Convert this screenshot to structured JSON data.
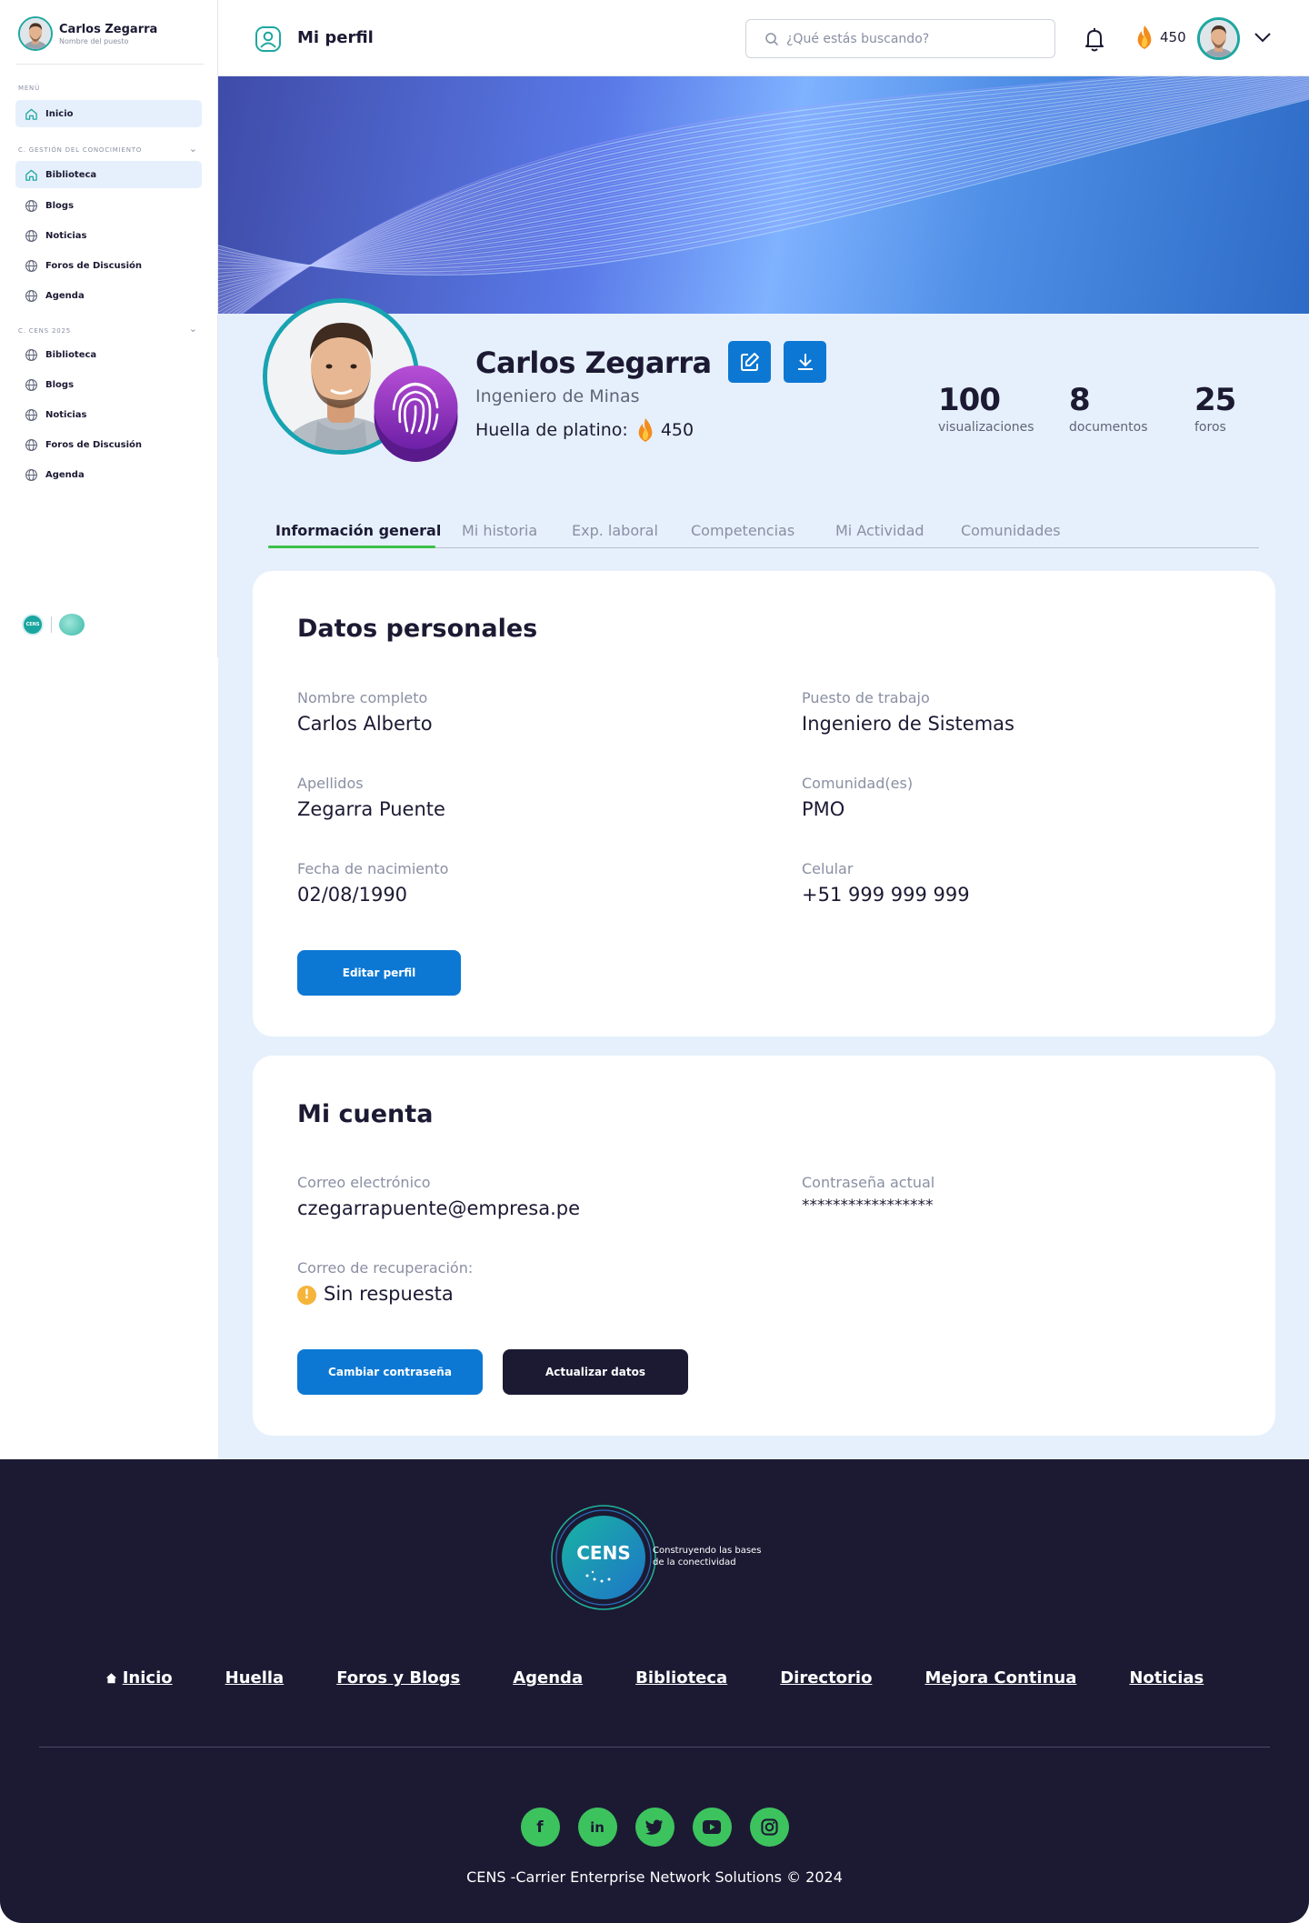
{
  "sidebar": {
    "user_name": "Carlos Zegarra",
    "user_role": "Nombre del puesto",
    "menu_label": "MENÚ",
    "home_item": "Inicio",
    "section1_label": "C. GESTIÓN DEL CONOCIMIENTO",
    "section1_items": [
      "Biblioteca",
      "Blogs",
      "Noticias",
      "Foros de Discusión",
      "Agenda"
    ],
    "section2_label": "C. CENS 2025",
    "section2_items": [
      "Biblioteca",
      "Blogs",
      "Noticias",
      "Foros de Discusión",
      "Agenda"
    ],
    "logo_text": "CENS"
  },
  "header": {
    "title": "Mi perfil",
    "search_placeholder": "¿Qué estás buscando?",
    "points": "450"
  },
  "profile": {
    "name": "Carlos Zegarra",
    "role": "Ingeniero de Minas",
    "huella_label": "Huella de platino:",
    "huella_points": "450",
    "stats": [
      {
        "value": "100",
        "label": "visualizaciones"
      },
      {
        "value": "8",
        "label": "documentos"
      },
      {
        "value": "25",
        "label": "foros"
      }
    ]
  },
  "tabs": [
    "Información general",
    "Mi historia",
    "Exp. laboral",
    "Competencias",
    "Mi Actividad",
    "Comunidades"
  ],
  "personal": {
    "title": "Datos personales",
    "fields": [
      {
        "label": "Nombre completo",
        "value": "Carlos Alberto"
      },
      {
        "label": "Puesto de trabajo",
        "value": "Ingeniero de Sistemas"
      },
      {
        "label": "Apellidos",
        "value": "Zegarra Puente"
      },
      {
        "label": "Comunidad(es)",
        "value": "PMO"
      },
      {
        "label": "Fecha de nacimiento",
        "value": "02/08/1990"
      },
      {
        "label": "Celular",
        "value": "+51 999 999 999"
      }
    ],
    "edit_button": "Editar perfil"
  },
  "account": {
    "title": "Mi cuenta",
    "email_label": "Correo electrónico",
    "email_value": "czegarrapuente@empresa.pe",
    "password_label": "Contraseña actual",
    "password_value": "*****************",
    "recovery_label": "Correo de recuperación:",
    "recovery_value": "Sin respuesta",
    "change_password_button": "Cambiar contraseña",
    "update_button": "Actualizar datos"
  },
  "footer": {
    "logo_text": "CENS",
    "tagline_line1": "Construyendo las bases",
    "tagline_line2": "de la conectividad",
    "links": [
      "Inicio",
      "Huella",
      "Foros y Blogs",
      "Agenda",
      "Biblioteca",
      "Directorio",
      "Mejora Continua",
      "Noticias"
    ],
    "social": [
      "facebook-icon",
      "linkedin-icon",
      "twitter-icon",
      "youtube-icon",
      "instagram-icon"
    ],
    "copyright": "CENS -Carrier Enterprise Network Solutions © 2024"
  },
  "colors": {
    "primary": "#0c78d4",
    "dark": "#1c1a33",
    "teal": "#1ea7a0",
    "tab_active": "#3bc14a",
    "social": "#3dc35e",
    "background": "#e6f0fc"
  }
}
